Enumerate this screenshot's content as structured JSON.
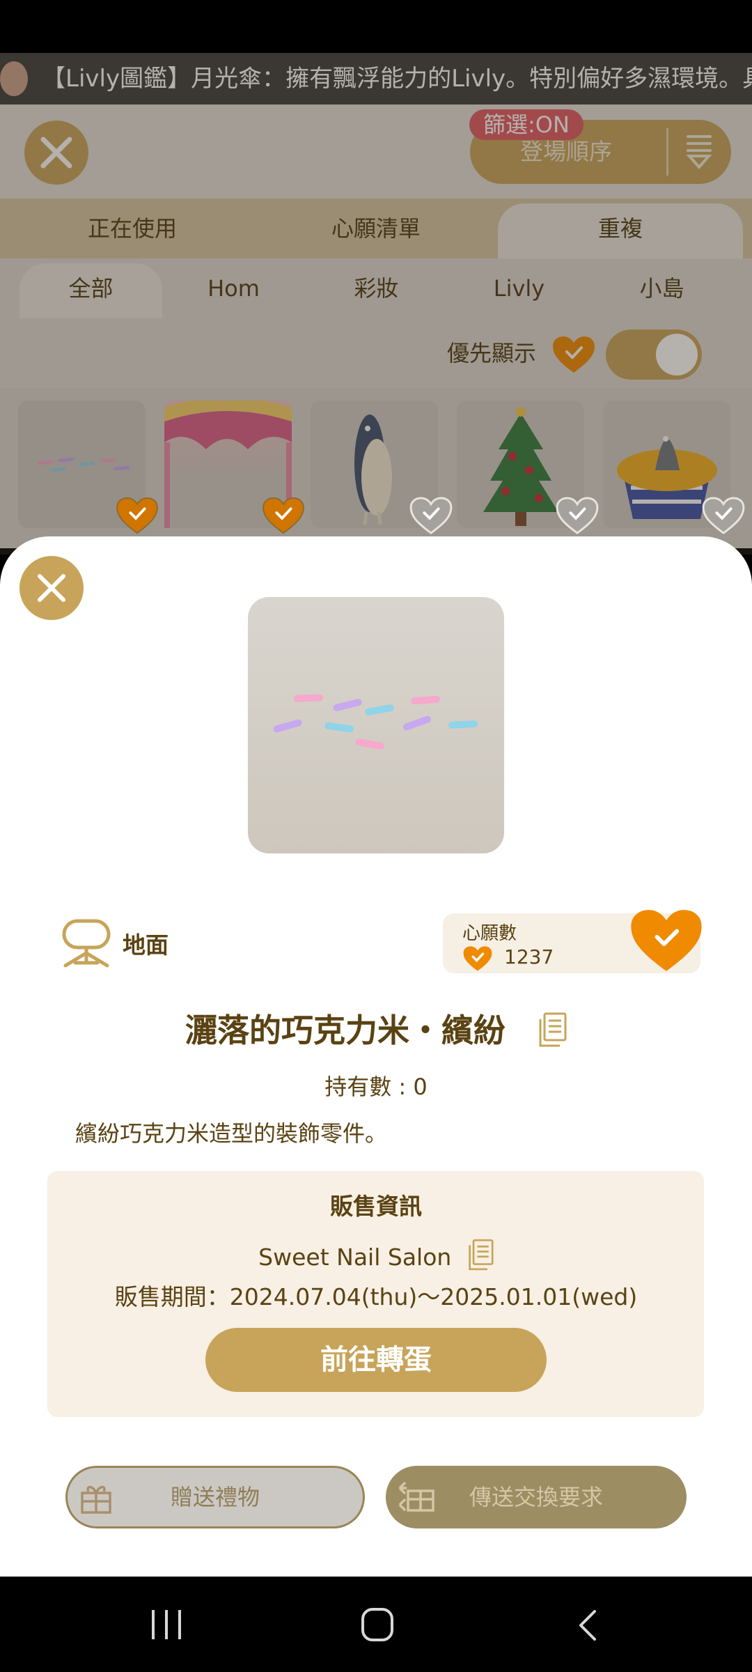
{
  "ticker": {
    "text": "【Livly圖鑑】月光傘：擁有飄浮能力的Livly。特別偏好多濕環境。具"
  },
  "header": {
    "sort_label": "登場順序",
    "filter_badge": "篩選:ON"
  },
  "tabs": [
    {
      "label": "正在使用",
      "selected": false
    },
    {
      "label": "心願清單",
      "selected": false
    },
    {
      "label": "重複",
      "selected": true
    }
  ],
  "subtabs": [
    {
      "label": "全部",
      "selected": true
    },
    {
      "label": "Hom",
      "selected": false
    },
    {
      "label": "彩妝",
      "selected": false
    },
    {
      "label": "Livly",
      "selected": false
    },
    {
      "label": "小島",
      "selected": false
    }
  ],
  "priority": {
    "label": "優先顯示",
    "toggle_on": true
  },
  "grid": {
    "items": [
      {
        "icon": "sprinkles-thumb",
        "wished": true
      },
      {
        "icon": "rainbow-cake-thumb",
        "wished": true
      },
      {
        "icon": "fish-figure-thumb",
        "wished": false
      },
      {
        "icon": "christmas-tree-thumb",
        "wished": false
      },
      {
        "icon": "fish-pie-thumb",
        "wished": false
      }
    ]
  },
  "detail": {
    "category": "地面",
    "wish_label": "心願數",
    "wish_count": "1237",
    "name": "灑落的巧克力米・繽紛",
    "owned": "持有數 : 0",
    "description": "繽紛巧克力米造型的裝飾零件。",
    "sale": {
      "title": "販售資訊",
      "source": "Sweet Nail Salon",
      "period": "販售期間：2024.07.04(thu)～2025.01.01(wed)",
      "button": "前往轉蛋"
    },
    "gift_button": "贈送禮物",
    "trade_button": "傳送交換要求"
  },
  "colors": {
    "gold": "#c7a45a",
    "orange": "#f08a00",
    "text": "#5a4212",
    "badge": "#e05763"
  }
}
